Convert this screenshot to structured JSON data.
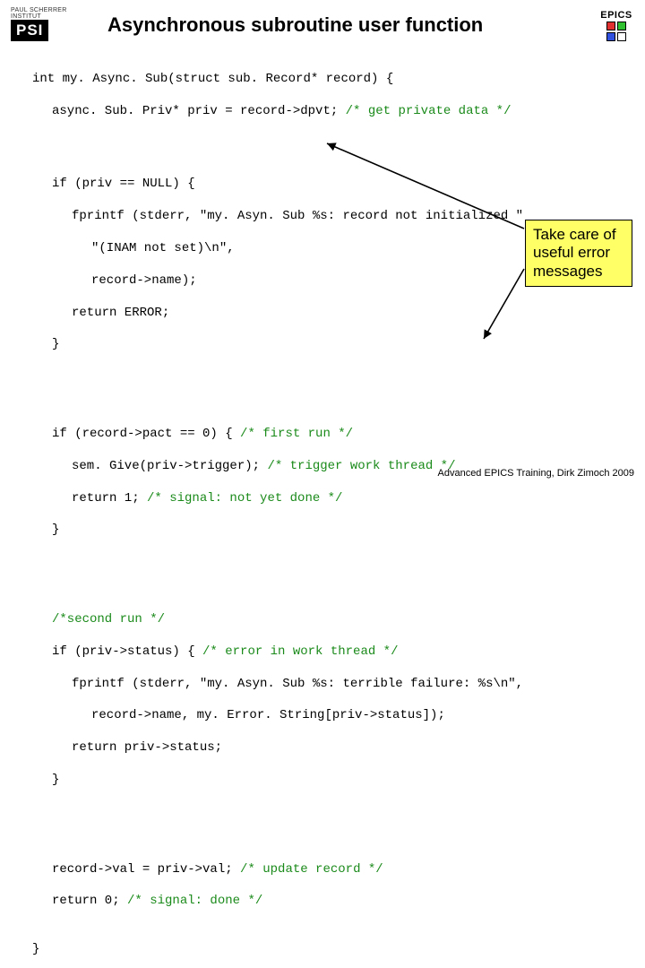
{
  "logo": {
    "institute": "PAUL SCHERRER INSTITUT",
    "acronym": "PSI"
  },
  "title": "Asynchronous subroutine user function",
  "epics": "EPICS",
  "code": {
    "l1a": "int my. Async. Sub(struct sub. Record* record) {",
    "l1b": "async. Sub. Priv* priv = record->dpvt; ",
    "l1c": "/* get private data */",
    "l2a": "if (priv == NULL) {",
    "l2b": "fprintf (stderr, \"my. Asyn. Sub %s: record not initialized \"",
    "l2c": "\"(INAM not set)\\n\",",
    "l2d": "record->name);",
    "l2e": "return ERROR;",
    "l2f": "}",
    "l3a": "if (record->pact == 0) { ",
    "l3a_c": "/* first run */",
    "l3b": "sem. Give(priv->trigger); ",
    "l3b_c": "/* trigger work thread */",
    "l3c": "return 1; ",
    "l3c_c": "/* signal: not yet done */",
    "l3d": "}",
    "l4a": "/*second run */",
    "l4b": "if (priv->status) { ",
    "l4b_c": "/* error in work thread */",
    "l4c": "fprintf (stderr, \"my. Asyn. Sub %s: terrible failure: %s\\n\",",
    "l4d": "record->name, my. Error. String[priv->status]);",
    "l4e": "return priv->status;",
    "l4f": "}",
    "l5a": "record->val = priv->val; ",
    "l5a_c": "/* update record */",
    "l5b": "return 0; ",
    "l5b_c": "/* signal: done */",
    "l6": "}"
  },
  "callout": "Take care of useful error messages",
  "footer": "Advanced EPICS Training, Dirk Zimoch 2009"
}
